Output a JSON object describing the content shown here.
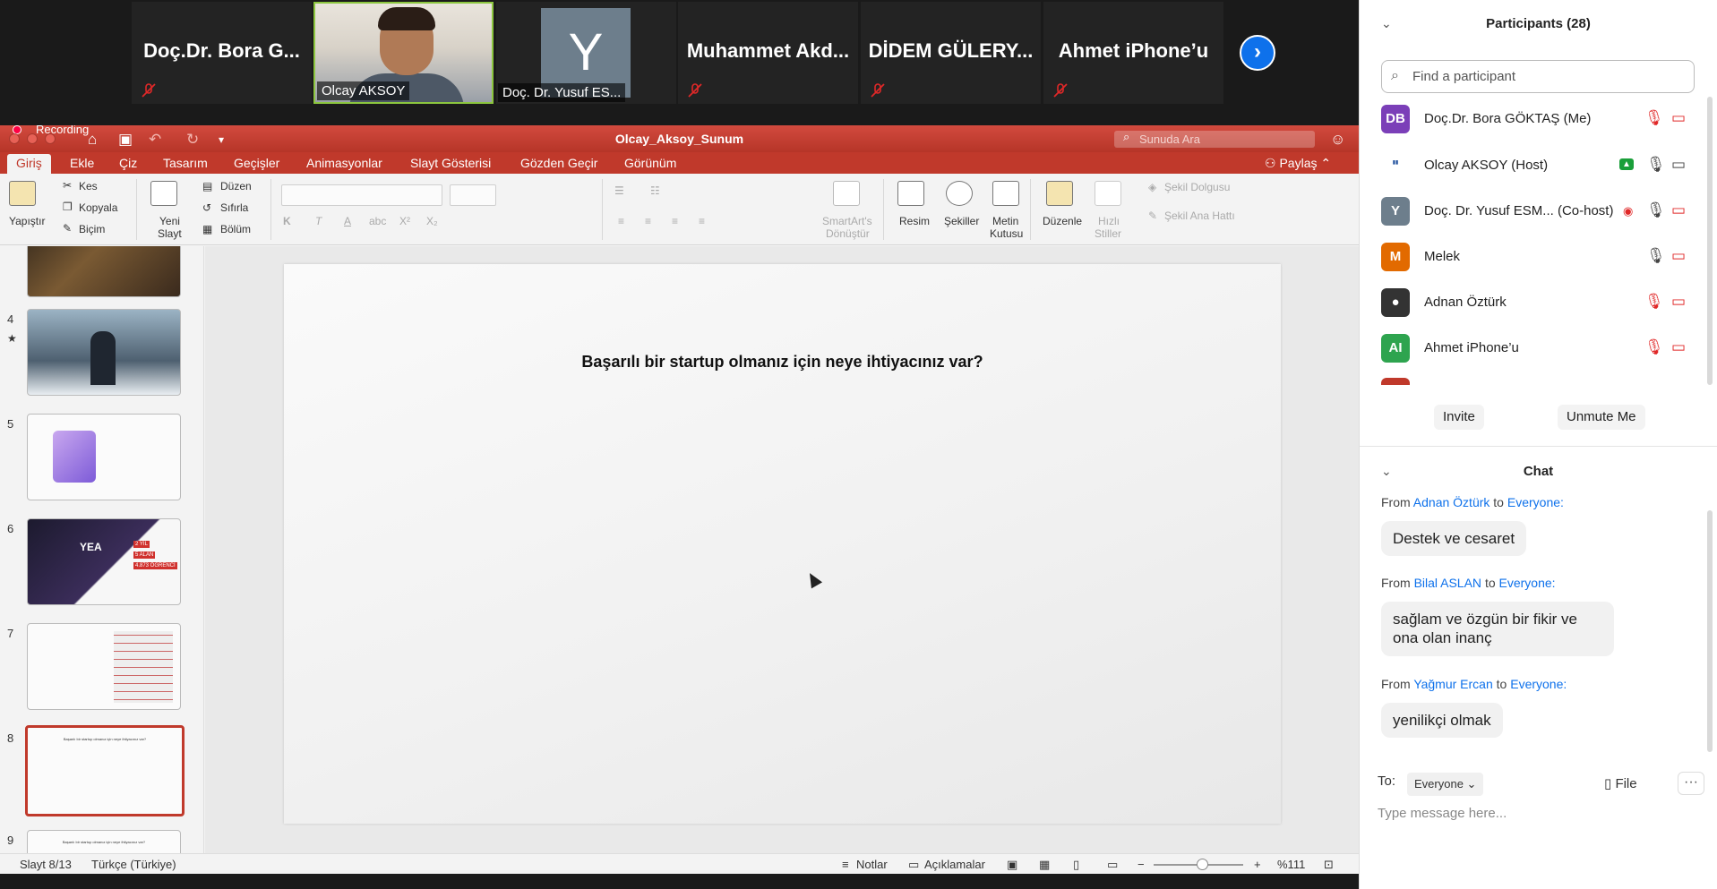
{
  "video_strip": {
    "tiles": [
      {
        "name": "Doç.Dr. Bora G..."
      },
      {
        "label": "Olcay AKSOY"
      },
      {
        "avatar_letter": "Y",
        "label": "Doç. Dr. Yusuf ES..."
      },
      {
        "name": "Muhammet  Akd..."
      },
      {
        "name": "DİDEM GÜLERY..."
      },
      {
        "name": "Ahmet iPhone’u"
      }
    ],
    "next_icon": "›"
  },
  "ppt": {
    "recording_label": "Recording",
    "doc_title": "Olcay_Aksoy_Sunum",
    "search_placeholder": "Sunuda Ara",
    "menu": [
      "Giriş",
      "Ekle",
      "Çiz",
      "Tasarım",
      "Geçişler",
      "Animasyonlar",
      "Slayt Gösterisi",
      "Gözden Geçir",
      "Görünüm"
    ],
    "share_label": "Paylaş",
    "ribbon": {
      "yapistir": "Yapıştır",
      "kes": "Kes",
      "kopyala": "Kopyala",
      "bicim": "Biçim",
      "yeni": "Yeni",
      "slayt": "Slayt",
      "duzen": "Düzen",
      "sifirla": "Sıfırla",
      "bolum": "Bölüm",
      "smartart1": "SmartArt's",
      "smartart2": "Dönüştür",
      "resim": "Resim",
      "sekiller": "Şekiller",
      "metin1": "Metin",
      "metin2": "Kutusu",
      "duzenle": "Düzenle",
      "hizli1": "Hızlı",
      "hizli2": "Stiller",
      "sekil_dolgusu": "Şekil Dolgusu",
      "sekil_ana_hatti": "Şekil Ana Hattı"
    },
    "thumbnails": {
      "numbers": [
        "4",
        "5",
        "6",
        "7",
        "8",
        "9"
      ],
      "slide6_text": [
        "YEA",
        "2 YIL",
        "5 ALAN",
        "4.873 ÖĞRENCİ"
      ]
    },
    "slide_title": "Başarılı bir startup olmanız için neye ihtiyacınız var?",
    "status": {
      "slide": "Slayt 8/13",
      "language": "Türkçe (Türkiye)",
      "notes": "Notlar",
      "comments": "Açıklamalar",
      "zoom": "%111"
    }
  },
  "participants": {
    "header": "Participants (28)",
    "find_placeholder": "Find a participant",
    "list": [
      {
        "initials": "DB",
        "name": "Doç.Dr. Bora GÖKTAŞ (Me)",
        "color": "#7b3fb8"
      },
      {
        "initials": "",
        "name": "Olcay AKSOY (Host)",
        "color": "#1e4f9c"
      },
      {
        "initials": "Y",
        "name": "Doç. Dr. Yusuf ESM... (Co-host)",
        "color": "#6d7e8c"
      },
      {
        "initials": "M",
        "name": "Melek",
        "color": "#e26a00"
      },
      {
        "initials": "",
        "name": "Adnan Öztürk",
        "color": "#333333"
      },
      {
        "initials": "AI",
        "name": "Ahmet iPhone’u",
        "color": "#2ea44f"
      }
    ],
    "invite_label": "Invite",
    "unmute_label": "Unmute Me"
  },
  "chat": {
    "header": "Chat",
    "messages": [
      {
        "from": "Adnan Öztürk",
        "to": "Everyone:",
        "text": "Destek ve cesaret"
      },
      {
        "from": "Bilal ASLAN",
        "to": "Everyone:",
        "text": "sağlam ve özgün bir fikir ve ona olan inanç"
      },
      {
        "from": "Yağmur Ercan",
        "to": "Everyone:",
        "text": "yenilikçi olmak"
      }
    ],
    "from_word": "From",
    "to_word": "to",
    "to_label": "To:",
    "to_value": "Everyone",
    "file_label": "File",
    "input_placeholder": "Type message here..."
  }
}
